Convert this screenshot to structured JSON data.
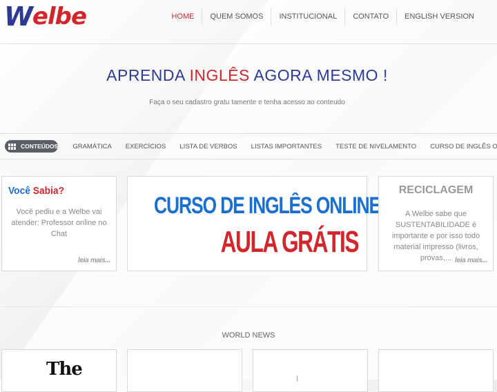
{
  "brand": {
    "logo_w": "W",
    "logo_rest": "elbe"
  },
  "topnav": [
    {
      "label": "HOME",
      "active": true
    },
    {
      "label": "QUEM SOMOS"
    },
    {
      "label": "INSTITUCIONAL"
    },
    {
      "label": "CONTATO"
    },
    {
      "label": "ENGLISH VERSION"
    }
  ],
  "hero": {
    "title_a": "APRENDA ",
    "title_b": "INGLÊS",
    "title_c": " AGORA MESMO !",
    "subtitle": "Faça o seu cadastro gratu tamente e tenha acesso ao conteudo"
  },
  "content_nav": {
    "pill_label": "CONTEÚDOS",
    "items": [
      "GRAMÁTICA",
      "EXERCÍCIOS",
      "LISTA DE VERBOS",
      "LISTAS IMPORTANTES",
      "TESTE DE NIVELAMENTO",
      "CURSO DE INGLÊS ONLINE"
    ]
  },
  "cards": {
    "voce": {
      "title_a": "Você ",
      "title_b": "Sabia?",
      "text": "Você pediu e a Welbe vai atender: Professor online no Chat",
      "more": "leia mais..."
    },
    "banner": {
      "line1_a": "CURSO DE INGLÊS ",
      "line1_b": "ONLINE",
      "line2": "AULA GRÁTIS"
    },
    "reciclagem": {
      "title": "RECICLAGEM",
      "text": "A Welbe sabe que SUSTENTABILIDADE é importante e por isso todo material impresso (livros, provas,...",
      "more": "leia mais..."
    }
  },
  "world_news": {
    "title": "WORLD NEWS",
    "first_logo": "The"
  },
  "colors": {
    "brand_blue": "#2d3a92",
    "brand_red": "#d0262c",
    "link_blue": "#1a6fd0"
  }
}
